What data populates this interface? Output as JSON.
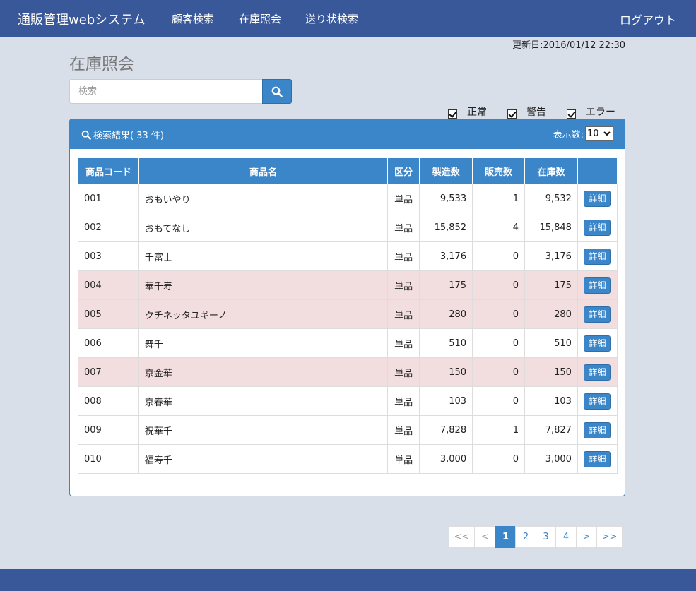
{
  "nav": {
    "brand": "通販管理webシステム",
    "links": [
      "顧客検索",
      "在庫照会",
      "送り状検索"
    ],
    "logout": "ログアウト"
  },
  "updated": "更新日:2016/01/12  22:30",
  "page_title": "在庫照会",
  "search": {
    "placeholder": "検索",
    "value": ""
  },
  "filters": [
    "正常",
    "警告",
    "エラー"
  ],
  "panel": {
    "title": "検索結果( 33 件)",
    "per_page_label": "表示数:",
    "per_page_value": "10"
  },
  "table": {
    "headers": [
      "商品コード",
      "商品名",
      "区分",
      "製造数",
      "販売数",
      "在庫数",
      ""
    ],
    "detail_label": "詳細",
    "rows": [
      {
        "code": "001",
        "name": "おもいやり",
        "kind": "単品",
        "made": "9,533",
        "sold": "1",
        "stock": "9,532",
        "warn": false
      },
      {
        "code": "002",
        "name": "おもてなし",
        "kind": "単品",
        "made": "15,852",
        "sold": "4",
        "stock": "15,848",
        "warn": false
      },
      {
        "code": "003",
        "name": "千富士",
        "kind": "単品",
        "made": "3,176",
        "sold": "0",
        "stock": "3,176",
        "warn": false
      },
      {
        "code": "004",
        "name": "華千寿",
        "kind": "単品",
        "made": "175",
        "sold": "0",
        "stock": "175",
        "warn": true
      },
      {
        "code": "005",
        "name": "クチネッタユギーノ",
        "kind": "単品",
        "made": "280",
        "sold": "0",
        "stock": "280",
        "warn": true
      },
      {
        "code": "006",
        "name": "舞千",
        "kind": "単品",
        "made": "510",
        "sold": "0",
        "stock": "510",
        "warn": false
      },
      {
        "code": "007",
        "name": "京金華",
        "kind": "単品",
        "made": "150",
        "sold": "0",
        "stock": "150",
        "warn": true
      },
      {
        "code": "008",
        "name": "京春華",
        "kind": "単品",
        "made": "103",
        "sold": "0",
        "stock": "103",
        "warn": false
      },
      {
        "code": "009",
        "name": "祝華千",
        "kind": "単品",
        "made": "7,828",
        "sold": "1",
        "stock": "7,827",
        "warn": false
      },
      {
        "code": "010",
        "name": "福寿千",
        "kind": "単品",
        "made": "3,000",
        "sold": "0",
        "stock": "3,000",
        "warn": false
      }
    ]
  },
  "pagination": {
    "items": [
      {
        "label": "<<",
        "state": "disabled"
      },
      {
        "label": "<",
        "state": "disabled"
      },
      {
        "label": "1",
        "state": "active"
      },
      {
        "label": "2",
        "state": "normal"
      },
      {
        "label": "3",
        "state": "normal"
      },
      {
        "label": "4",
        "state": "normal"
      },
      {
        "label": ">",
        "state": "normal"
      },
      {
        "label": ">>",
        "state": "normal"
      }
    ]
  },
  "colors": {
    "navbar": "#39589a",
    "accent": "#3b86c9",
    "warning_row": "#f2dede",
    "background": "#d9dfe9"
  }
}
